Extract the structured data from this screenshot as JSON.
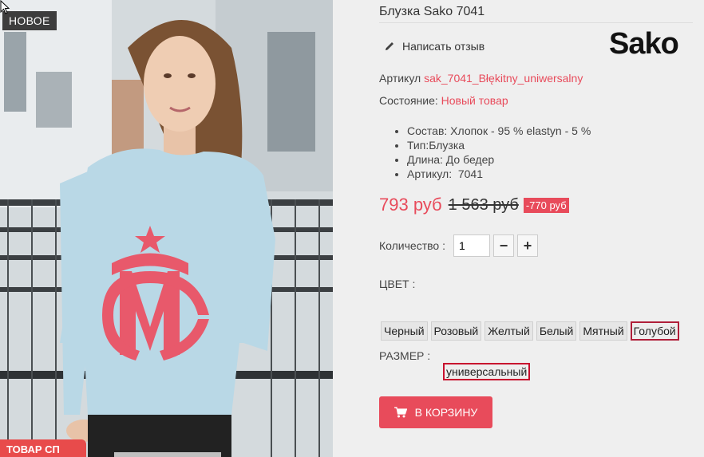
{
  "product": {
    "title": "Блузка Sako 7041",
    "badge_new": "НОВОЕ",
    "promo_strip": "ТОВАР СП",
    "brand": "Sako",
    "review_link": "Написать отзыв",
    "sku_label": "Артикул",
    "sku_value": "sak_7041_Błękitny_uniwersalny",
    "condition_label": "Состояние:",
    "condition_value": "Новый товар",
    "features": [
      "Состав: Хлопок - 95 % elastyn - 5 %",
      "Тип:Блузка",
      "Длина: До бедер",
      "Артикул:  7041"
    ],
    "price_current": "793 руб",
    "price_old": "1 563 руб",
    "discount": "-770 руб",
    "quantity_label": "Количество :",
    "quantity_value": "1",
    "minus": "−",
    "plus": "+",
    "color_label": "ЦВЕТ :",
    "colors": [
      "Черный",
      "Розовый",
      "Желтый",
      "Белый",
      "Мятный",
      "Голубой"
    ],
    "selected_color": "Голубой",
    "size_label": "РАЗМЕР :",
    "size_value": "универсальный",
    "cart_button": "В КОРЗИНУ"
  },
  "icons": {
    "review": "pencil-icon",
    "cart": "cart-icon",
    "cursor": "cursor-icon"
  },
  "colors_theme": {
    "accent": "#e84b5b",
    "selected_border": "#b01f3a",
    "background": "#efefef"
  }
}
